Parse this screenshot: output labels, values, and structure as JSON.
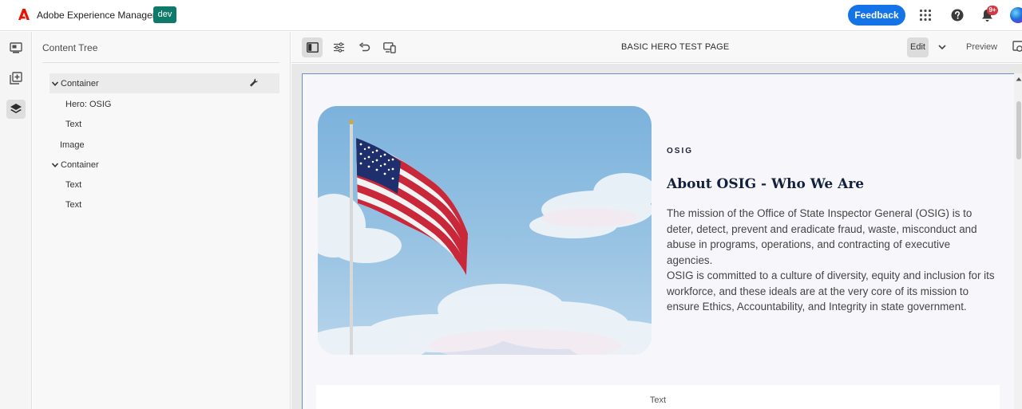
{
  "header": {
    "app_title": "Adobe Experience Manager",
    "env_badge": "dev",
    "feedback_label": "Feedback",
    "notification_count": "9+",
    "icons": [
      "adobe-logo-icon",
      "apps-grid-icon",
      "help-icon",
      "bell-icon",
      "avatar"
    ]
  },
  "rail": {
    "items": [
      "page-properties-icon",
      "add-component-icon",
      "layers-icon"
    ],
    "active": "layers-icon"
  },
  "content_tree": {
    "heading": "Content Tree",
    "items": [
      {
        "label": "Container",
        "expanded": true,
        "selected": true
      },
      {
        "label": "Hero: OSIG"
      },
      {
        "label": "Text"
      },
      {
        "label": "Image"
      },
      {
        "label": "Container",
        "expanded": true
      },
      {
        "label": "Text"
      },
      {
        "label": "Text"
      }
    ]
  },
  "toolbar": {
    "page_name": "BASIC HERO TEST PAGE",
    "edit_label": "Edit",
    "preview_label": "Preview"
  },
  "hero": {
    "eyebrow": "OSIG",
    "title": "About OSIG - Who We Are",
    "paragraph_1": "The mission of the Office of State Inspector General (OSIG) is to deter, detect, prevent and eradicate fraud, waste, misconduct and abuse in programs, operations, and contracting of executive agencies.",
    "paragraph_2": "OSIG is committed to a culture of diversity, equity and inclusion for its workforce, and these ideals are at the very core of its mission to ensure Ethics, Accountability, and Integrity in state government."
  },
  "text_block": {
    "label": "Text"
  },
  "colors": {
    "accent_blue": "#1473e6",
    "env_badge": "#0d7a6a",
    "notification": "#d7373f",
    "hero_title": "#14213d"
  }
}
